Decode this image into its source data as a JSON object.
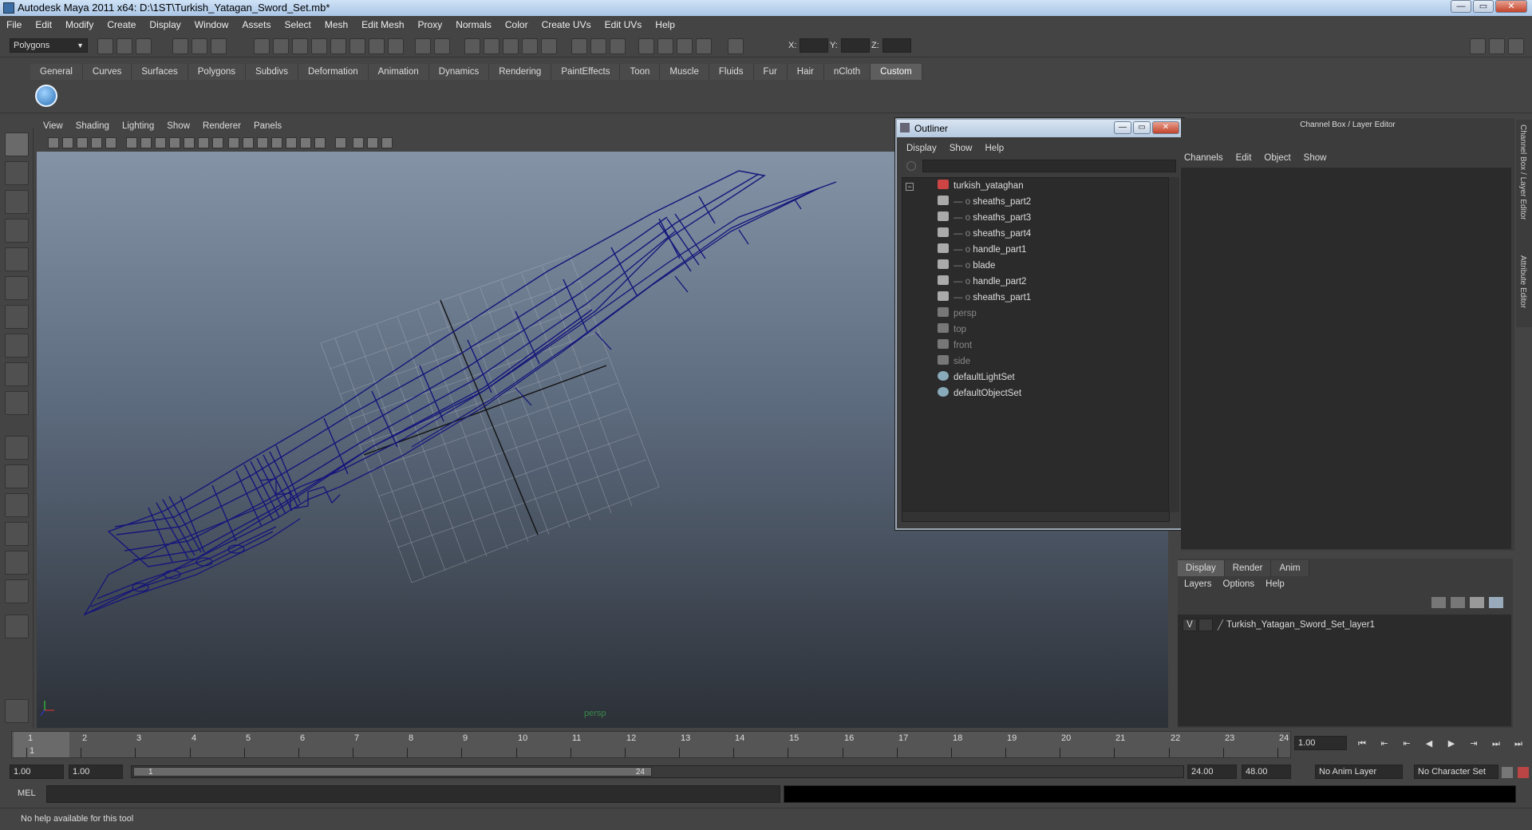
{
  "window": {
    "title": "Autodesk Maya 2011 x64: D:\\1ST\\Turkish_Yatagan_Sword_Set.mb*",
    "controls": [
      "—",
      "▭",
      "✕"
    ]
  },
  "menubar": [
    "File",
    "Edit",
    "Modify",
    "Create",
    "Display",
    "Window",
    "Assets",
    "Select",
    "Mesh",
    "Edit Mesh",
    "Proxy",
    "Normals",
    "Color",
    "Create UVs",
    "Edit UVs",
    "Help"
  ],
  "statusline": {
    "menu_set": "Polygons",
    "x_label": "X:",
    "y_label": "Y:",
    "z_label": "Z:"
  },
  "shelf": {
    "tabs": [
      "General",
      "Curves",
      "Surfaces",
      "Polygons",
      "Subdivs",
      "Deformation",
      "Animation",
      "Dynamics",
      "Rendering",
      "PaintEffects",
      "Toon",
      "Muscle",
      "Fluids",
      "Fur",
      "Hair",
      "nCloth",
      "Custom"
    ],
    "active_tab": "Custom"
  },
  "viewport": {
    "menu": [
      "View",
      "Shading",
      "Lighting",
      "Show",
      "Renderer",
      "Panels"
    ],
    "camera_label": "persp",
    "wire_color": "#15157a"
  },
  "outliner": {
    "title": "Outliner",
    "menu": [
      "Display",
      "Show",
      "Help"
    ],
    "items": [
      {
        "label": "turkish_yataghan",
        "icon": "group-icon",
        "level": 0,
        "dim": false
      },
      {
        "label": "sheaths_part2",
        "icon": "mesh-icon",
        "level": 1,
        "dim": false
      },
      {
        "label": "sheaths_part3",
        "icon": "mesh-icon",
        "level": 1,
        "dim": false
      },
      {
        "label": "sheaths_part4",
        "icon": "mesh-icon",
        "level": 1,
        "dim": false
      },
      {
        "label": "handle_part1",
        "icon": "mesh-icon",
        "level": 1,
        "dim": false
      },
      {
        "label": "blade",
        "icon": "mesh-icon",
        "level": 1,
        "dim": false
      },
      {
        "label": "handle_part2",
        "icon": "mesh-icon",
        "level": 1,
        "dim": false
      },
      {
        "label": "sheaths_part1",
        "icon": "mesh-icon",
        "level": 1,
        "dim": false
      },
      {
        "label": "persp",
        "icon": "camera-icon",
        "level": 0,
        "dim": true
      },
      {
        "label": "top",
        "icon": "camera-icon",
        "level": 0,
        "dim": true
      },
      {
        "label": "front",
        "icon": "camera-icon",
        "level": 0,
        "dim": true
      },
      {
        "label": "side",
        "icon": "camera-icon",
        "level": 0,
        "dim": true
      },
      {
        "label": "defaultLightSet",
        "icon": "set-icon",
        "level": 0,
        "dim": false
      },
      {
        "label": "defaultObjectSet",
        "icon": "set-icon",
        "level": 0,
        "dim": false
      }
    ]
  },
  "channelbox": {
    "title": "Channel Box / Layer Editor",
    "menu": [
      "Channels",
      "Edit",
      "Object",
      "Show"
    ]
  },
  "layers": {
    "tabs": [
      "Display",
      "Render",
      "Anim"
    ],
    "active_tab": "Display",
    "menu": [
      "Layers",
      "Options",
      "Help"
    ],
    "rows": [
      {
        "visible": "V",
        "name": "Turkish_Yatagan_Sword_Set_layer1"
      }
    ]
  },
  "sidetabs": [
    "Channel Box / Layer Editor",
    "Attribute Editor"
  ],
  "timeline": {
    "ticks": [
      "1",
      "2",
      "3",
      "4",
      "5",
      "6",
      "7",
      "8",
      "9",
      "10",
      "11",
      "12",
      "13",
      "14",
      "15",
      "16",
      "17",
      "18",
      "19",
      "20",
      "21",
      "22",
      "23",
      "24"
    ],
    "current_frame_marker": "1",
    "current_frame": "1.00"
  },
  "playback": [
    "⏮",
    "⏭",
    "⇤",
    "◀",
    "▶",
    "⇥",
    "⏭",
    "⏭"
  ],
  "range": {
    "start": "1.00",
    "playback_start": "1.00",
    "handle_start": "1",
    "handle_end": "24",
    "playback_end": "24.00",
    "end": "48.00",
    "anim_layer": "No Anim Layer",
    "character_set": "No Character Set"
  },
  "commandline": {
    "language": "MEL"
  },
  "helpline": {
    "text": "No help available for this tool"
  }
}
